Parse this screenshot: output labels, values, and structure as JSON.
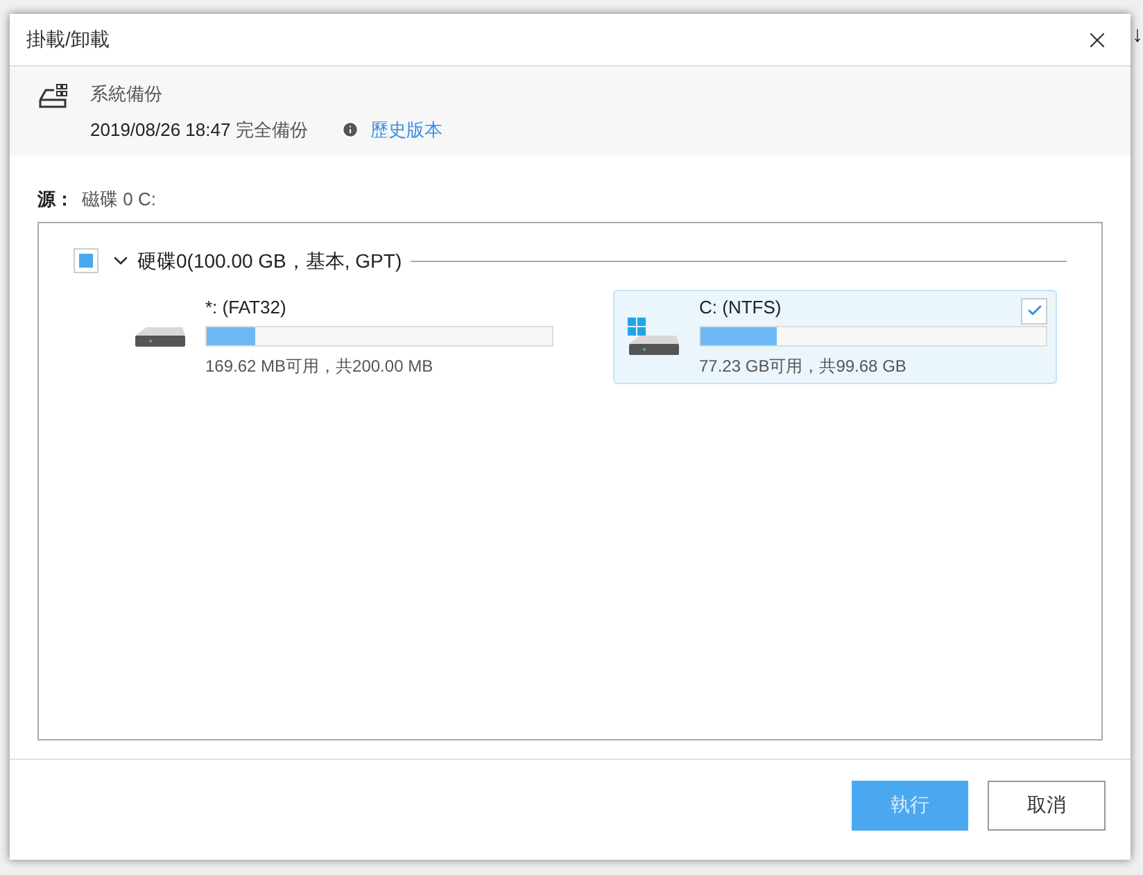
{
  "background_glyph": "↓",
  "dialog": {
    "title": "掛載/卸載",
    "backup": {
      "name": "系統備份",
      "date": "2019/08/26 18:47",
      "type": "完全備份",
      "history_link": "歷史版本"
    },
    "source": {
      "label": "源：",
      "value_prefix": "磁碟",
      "value": "0 C:"
    },
    "disk": {
      "label": "硬碟0(100.00 GB，基本, GPT)",
      "partial": true,
      "expanded": true,
      "partitions": [
        {
          "kind": "plain",
          "name": "*: (FAT32)",
          "level": 0.14,
          "usage": "169.62 MB可用，共200.00 MB",
          "selected": false
        },
        {
          "kind": "windows",
          "name": "C: (NTFS)",
          "level": 0.22,
          "usage": "77.23 GB可用，共99.68 GB",
          "selected": true
        }
      ]
    },
    "buttons": [
      {
        "label": "執行",
        "kind": "primary",
        "disabled": true
      },
      {
        "label": "取消",
        "kind": "secondary",
        "disabled": false
      }
    ]
  }
}
